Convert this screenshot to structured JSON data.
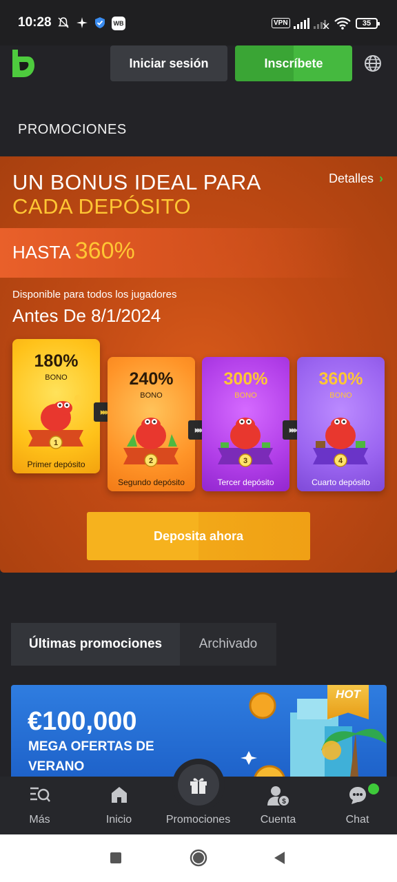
{
  "status_bar": {
    "time": "10:28",
    "vpn": "VPN",
    "battery": "35",
    "wb": "WB"
  },
  "header": {
    "login_label": "Iniciar sesión",
    "signup_label": "Inscríbete"
  },
  "page_title": "PROMOCIONES",
  "promo": {
    "title_line1": "UN BONUS IDEAL PARA",
    "title_line2": "CADA DEPÓSITO",
    "details_label": "Detalles",
    "hasta_label": "HASTA",
    "hasta_value": "360%",
    "available_text": "Disponible para todos los jugadores",
    "deadline_text": "Antes De 8/1/2024",
    "cards": [
      {
        "percent": "180%",
        "bono": "BONO",
        "step": "1",
        "label": "Primer depósito"
      },
      {
        "percent": "240%",
        "bono": "BONO",
        "step": "2",
        "label": "Segundo depósito"
      },
      {
        "percent": "300%",
        "bono": "BONO",
        "step": "3",
        "label": "Tercer depósito"
      },
      {
        "percent": "360%",
        "bono": "BONO",
        "step": "4",
        "label": "Cuarto depósito"
      }
    ],
    "deposit_button_label": "Deposita ahora"
  },
  "tabs": [
    {
      "label": "Últimas promociones",
      "active": true
    },
    {
      "label": "Archivado",
      "active": false
    }
  ],
  "hot_card": {
    "badge": "HOT",
    "amount": "€100,000",
    "line1": "MEGA OFERTAS DE",
    "line2": "VERANO"
  },
  "bottom_nav": [
    {
      "label": "Más",
      "icon": "search-list-icon"
    },
    {
      "label": "Inicio",
      "icon": "home-icon"
    },
    {
      "label": "Promociones",
      "icon": "gift-icon"
    },
    {
      "label": "Cuenta",
      "icon": "account-icon"
    },
    {
      "label": "Chat",
      "icon": "chat-icon"
    }
  ],
  "colors": {
    "brand_green": "#3aa535",
    "accent_yellow": "#ffc634",
    "promo_orange": "#c14a14",
    "deposit_button": "#f6b21e"
  }
}
